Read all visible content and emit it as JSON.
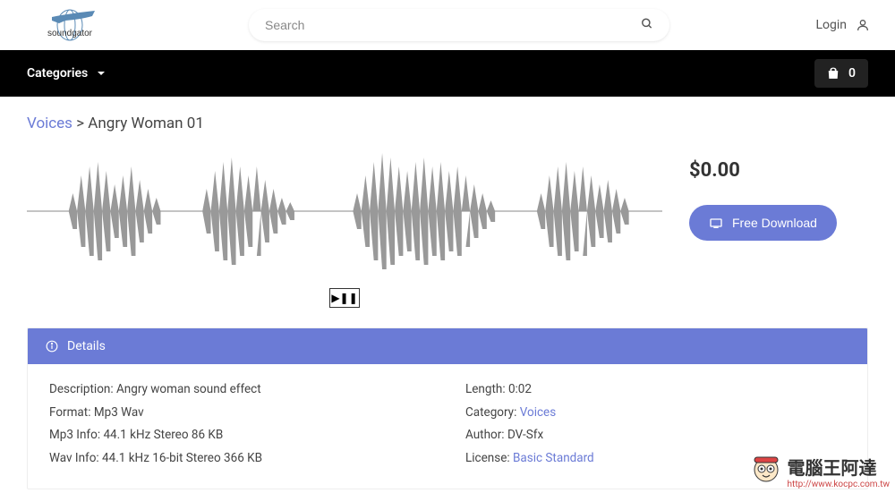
{
  "brand": "soundgator",
  "search": {
    "placeholder": "Search"
  },
  "login_label": "Login",
  "nav": {
    "categories": "Categories",
    "cart_count": "0"
  },
  "breadcrumb": {
    "category": "Voices",
    "sep": ">",
    "title": "Angry Woman 01"
  },
  "price": "$0.00",
  "download_label": "Free Download",
  "details_header": "Details",
  "details": {
    "left": {
      "description_label": "Description:",
      "description": "Angry woman sound effect",
      "format_label": "Format:",
      "format": "Mp3 Wav",
      "mp3_label": "Mp3 Info:",
      "mp3": "44.1 kHz Stereo 86 KB",
      "wav_label": "Wav Info:",
      "wav": "44.1 kHz 16-bit Stereo 366 KB"
    },
    "right": {
      "length_label": "Length:",
      "length": "0:02",
      "category_label": "Category:",
      "category": "Voices",
      "author_label": "Author:",
      "author": "DV-Sfx",
      "license_label": "License:",
      "license": "Basic Standard"
    }
  },
  "watermark": {
    "title": "電腦王阿達",
    "url": "http://www.kocpc.com.tw"
  }
}
